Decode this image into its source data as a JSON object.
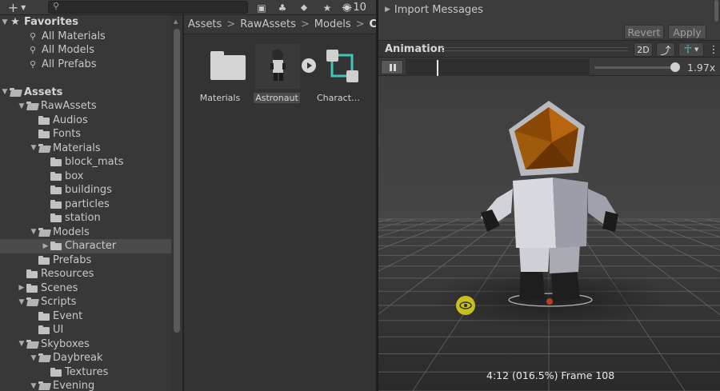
{
  "toolbar": {
    "add_label": "+",
    "search_placeholder": "",
    "hidden_count": "10"
  },
  "tree": {
    "favorites_label": "Favorites",
    "favorites": [
      "All Materials",
      "All Models",
      "All Prefabs"
    ],
    "assets_label": "Assets",
    "rows": [
      {
        "label": "RawAssets",
        "depth": 1,
        "expanded": true
      },
      {
        "label": "Audios",
        "depth": 2
      },
      {
        "label": "Fonts",
        "depth": 2
      },
      {
        "label": "Materials",
        "depth": 2,
        "expanded": true
      },
      {
        "label": "block_mats",
        "depth": 3
      },
      {
        "label": "box",
        "depth": 3
      },
      {
        "label": "buildings",
        "depth": 3
      },
      {
        "label": "particles",
        "depth": 3
      },
      {
        "label": "station",
        "depth": 3
      },
      {
        "label": "Models",
        "depth": 2,
        "expanded": true
      },
      {
        "label": "Character",
        "depth": 3,
        "collapsed": true,
        "selected": true
      },
      {
        "label": "Prefabs",
        "depth": 2
      },
      {
        "label": "Resources",
        "depth": 1
      },
      {
        "label": "Scenes",
        "depth": 1,
        "collapsed": true
      },
      {
        "label": "Scripts",
        "depth": 1,
        "expanded": true
      },
      {
        "label": "Event",
        "depth": 2
      },
      {
        "label": "UI",
        "depth": 2
      },
      {
        "label": "Skyboxes",
        "depth": 1,
        "expanded": true
      },
      {
        "label": "Daybreak",
        "depth": 2,
        "expanded": true
      },
      {
        "label": "Textures",
        "depth": 3
      },
      {
        "label": "Evening",
        "depth": 2,
        "expanded": true
      }
    ]
  },
  "breadcrumb": [
    "Assets",
    "RawAssets",
    "Models",
    "Ch"
  ],
  "assets": [
    {
      "label": "Materials",
      "kind": "folder"
    },
    {
      "label": "Astronaut",
      "kind": "model",
      "selected": true
    },
    {
      "label": "Charact…",
      "kind": "prefab"
    }
  ],
  "inspector": {
    "import_messages": "Import Messages",
    "revert_label": "Revert",
    "apply_label": "Apply"
  },
  "animation": {
    "title": "Animation",
    "mode_2d": "2D",
    "speed_label": "1.97x",
    "speed_fraction": 0.95,
    "playhead_fraction": 0.17,
    "frame_label": "4:12 (016.5%) Frame 108"
  },
  "colors": {
    "panel_bg": "#383838",
    "selection": "#4b4b4b",
    "accent_teal": "#3ec5b7",
    "helmet_orange": "#b8650f",
    "eye_marker": "#c8be1e"
  }
}
